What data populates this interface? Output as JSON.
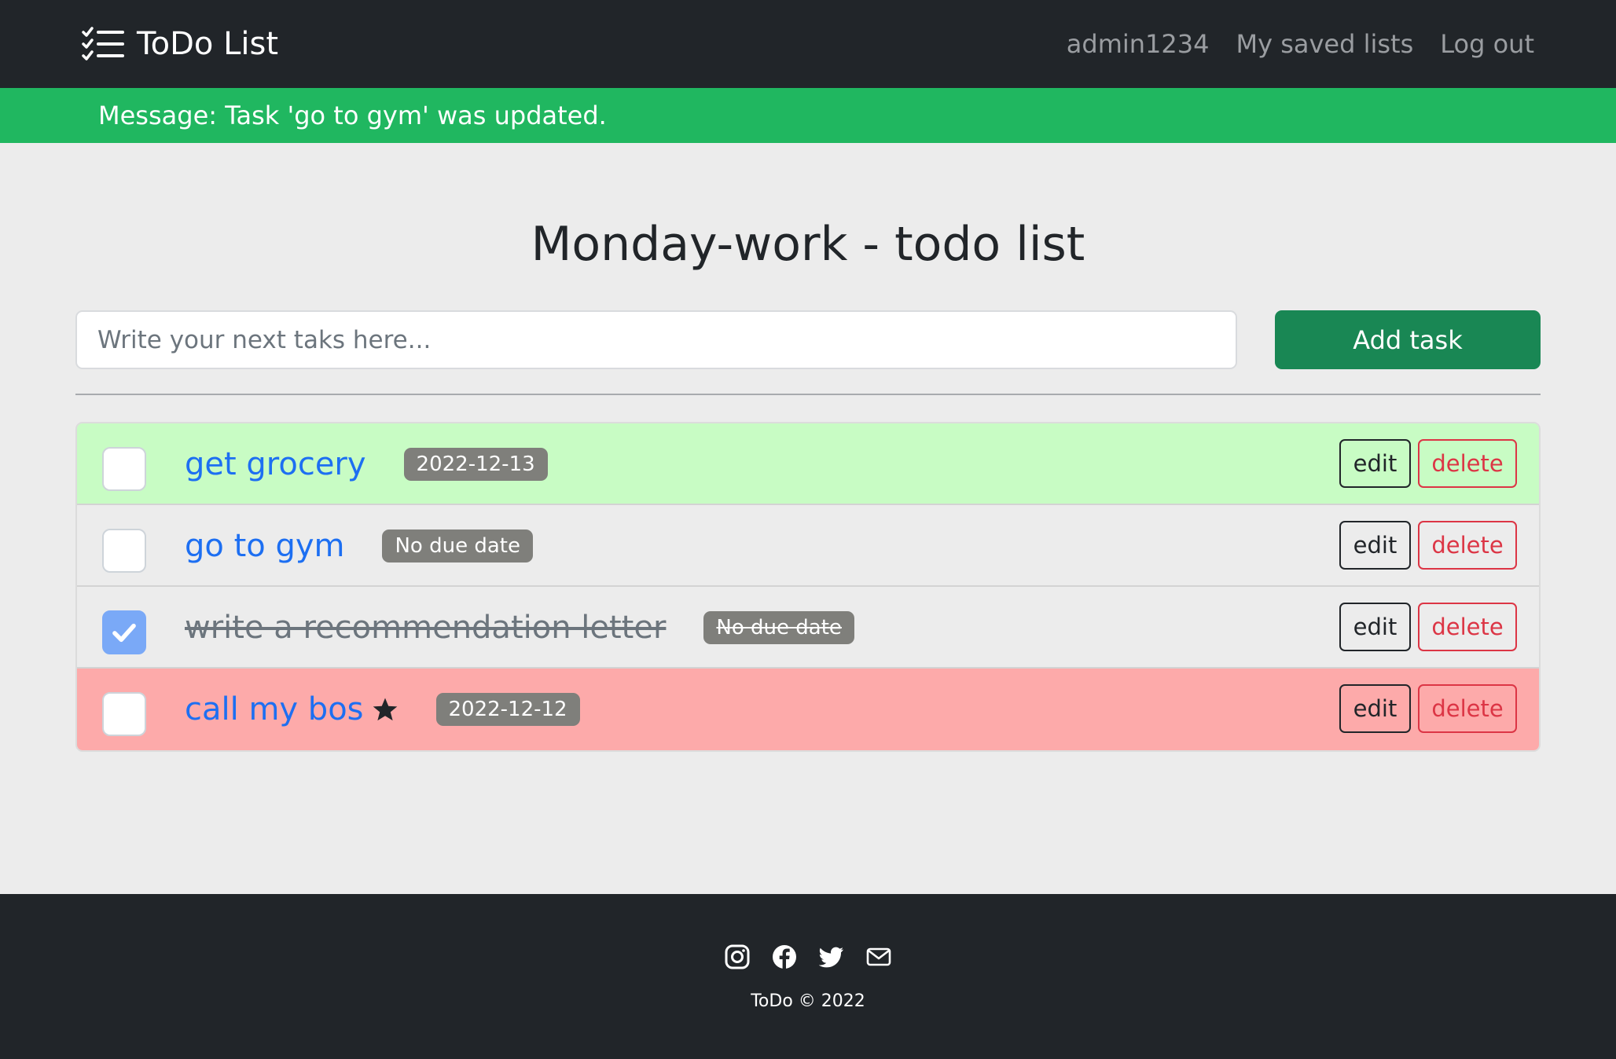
{
  "navbar": {
    "brand": "ToDo List",
    "links": [
      "admin1234",
      "My saved lists",
      "Log out"
    ]
  },
  "message": "Message: Task 'go to gym' was updated.",
  "page": {
    "title": "Monday-work - todo list",
    "input_placeholder": "Write your next taks here...",
    "add_button": "Add task"
  },
  "tasks": [
    {
      "name": "get grocery",
      "due": "2022-12-13",
      "done": false,
      "color": "#c8fcc4",
      "starred": false
    },
    {
      "name": "go to gym",
      "due": "No due date",
      "done": false,
      "color": "#ececec",
      "starred": false
    },
    {
      "name": "write a recommendation letter",
      "due": "No due date",
      "done": true,
      "color": "#ececec",
      "starred": false
    },
    {
      "name": "call my bos",
      "due": "2022-12-12",
      "done": false,
      "color": "#fdaaaa",
      "starred": true
    }
  ],
  "task_actions": {
    "edit": "edit",
    "delete": "delete"
  },
  "footer": {
    "icons": [
      "instagram-icon",
      "facebook-icon",
      "twitter-icon",
      "mail-icon"
    ],
    "copyright": "ToDo © 2022"
  }
}
